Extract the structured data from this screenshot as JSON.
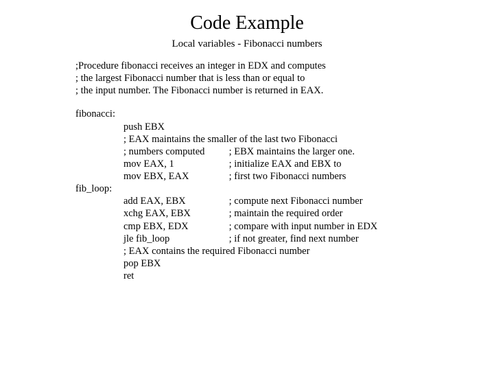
{
  "title": "Code Example",
  "subtitle": "Local variables - Fibonacci numbers",
  "intro": {
    "l1": ";Procedure fibonacci receives an integer in EDX and computes",
    "l2": "; the largest Fibonacci number that is less than or equal to",
    "l3": "; the input number. The Fibonacci number is returned in EAX."
  },
  "labels": {
    "fib": "fibonacci:",
    "loop": "fib_loop:"
  },
  "block1": {
    "l1": "push EBX",
    "l2": "; EAX maintains the smaller of the last two Fibonacci",
    "l3a": "; numbers computed",
    "l3b": "; EBX maintains the larger one.",
    "l4a": "mov EAX, 1",
    "l4b": "; initialize EAX and EBX to",
    "l5a": "mov EBX, EAX",
    "l5b": "; first two Fibonacci numbers"
  },
  "block2": {
    "l1a": "add EAX, EBX",
    "l1b": "; compute next Fibonacci number",
    "l2a": "xchg EAX, EBX",
    "l2b": "; maintain the required order",
    "l3a": "cmp EBX, EDX",
    "l3b": "; compare with input number in EDX",
    "l4a": "jle fib_loop",
    "l4b": "; if not greater, find next number",
    "l5": "; EAX contains the required Fibonacci number",
    "l6": "pop EBX",
    "l7": "ret"
  }
}
